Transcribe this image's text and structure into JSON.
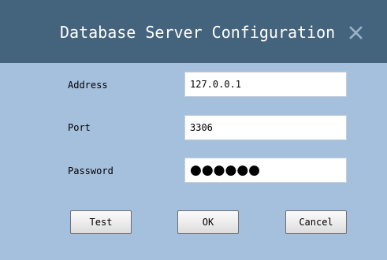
{
  "dialog": {
    "title": "Database Server Configuration",
    "close_icon": "close-icon"
  },
  "form": {
    "address": {
      "label": "Address",
      "value": "127.0.0.1"
    },
    "port": {
      "label": "Port",
      "value": "3306"
    },
    "password": {
      "label": "Password",
      "value": "●●●●●●"
    }
  },
  "buttons": {
    "test": "Test",
    "ok": "OK",
    "cancel": "Cancel"
  },
  "colors": {
    "titlebar": "#44637d",
    "body": "#a5c0dd",
    "field": "#ffffff",
    "close_x": "#9bb3c9"
  }
}
